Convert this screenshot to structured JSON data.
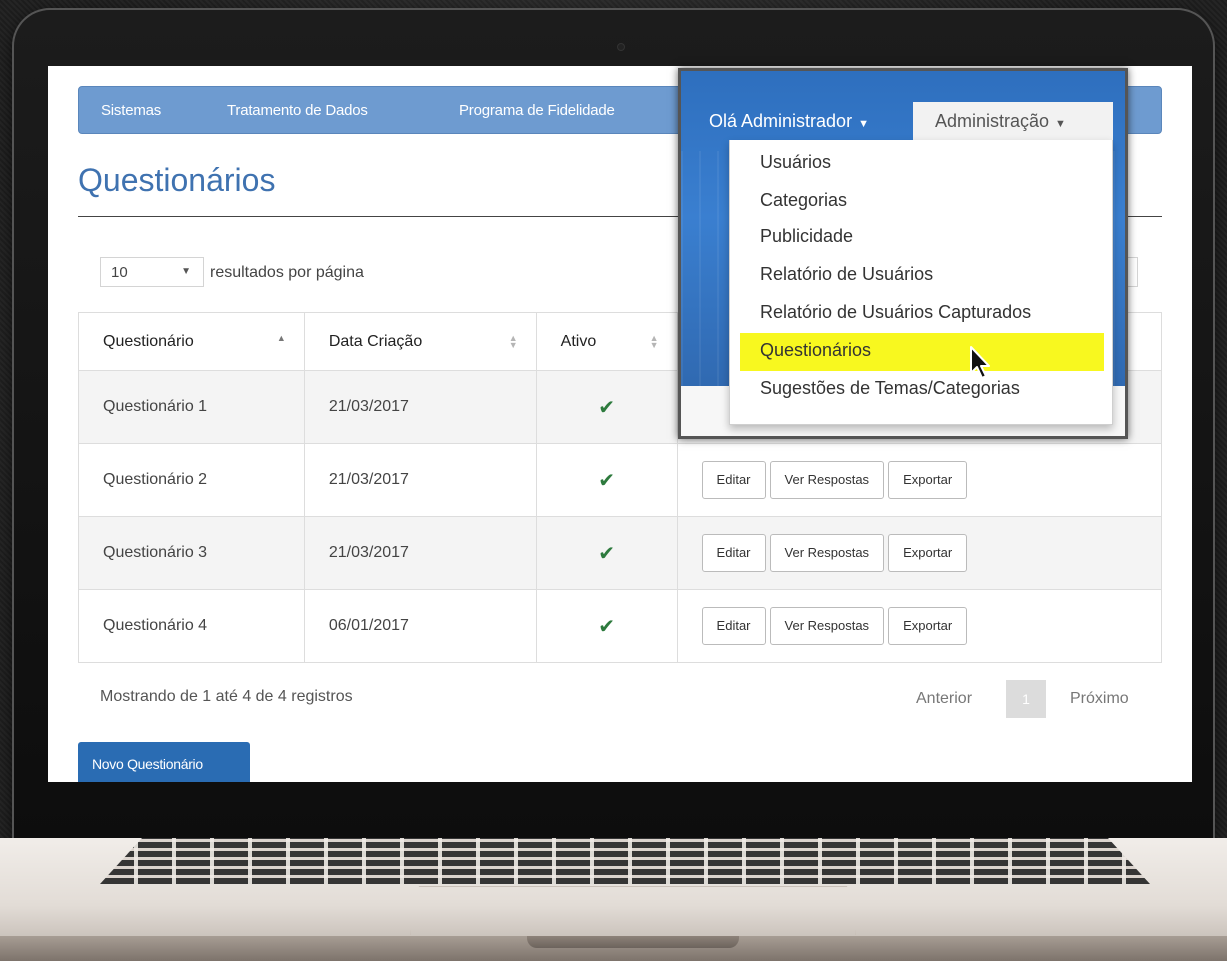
{
  "navbar": {
    "links": [
      "Sistemas",
      "Tratamento de Dados",
      "Programa de Fidelidade"
    ],
    "greeting": "Olá Administrador",
    "admin_menu": "Administração"
  },
  "admin_dropdown": {
    "items": [
      "Usuários",
      "Categorias",
      "Publicidade",
      "Relatório de Usuários",
      "Relatório de Usuários Capturados",
      "Questionários",
      "Sugestões de Temas/Categorias"
    ],
    "highlighted": "Questionários"
  },
  "page": {
    "title": "Questionários",
    "per_page_value": "10",
    "per_page_label": "resultados por página"
  },
  "table": {
    "headers": [
      "Questionário",
      "Data Criação",
      "Ativo",
      ""
    ],
    "rows": [
      {
        "name": "Questionário 1",
        "date": "21/03/2017",
        "active": "✔"
      },
      {
        "name": "Questionário 2",
        "date": "21/03/2017",
        "active": "✔"
      },
      {
        "name": "Questionário 3",
        "date": "21/03/2017",
        "active": "✔"
      },
      {
        "name": "Questionário 4",
        "date": "06/01/2017",
        "active": "✔"
      }
    ],
    "actions": {
      "edit": "Editar",
      "responses": "Ver Respostas",
      "export": "Exportar"
    }
  },
  "footer": {
    "info": "Mostrando de 1 até 4 de 4 registros",
    "prev": "Anterior",
    "current_page": "1",
    "next": "Próximo",
    "new_button": "Novo Questionário"
  },
  "colors": {
    "navbar": "#6e9bd0",
    "title": "#3f72b0",
    "primary_button": "#2a6cb3",
    "highlight": "#f8f81f",
    "check": "#2d7a3d"
  }
}
